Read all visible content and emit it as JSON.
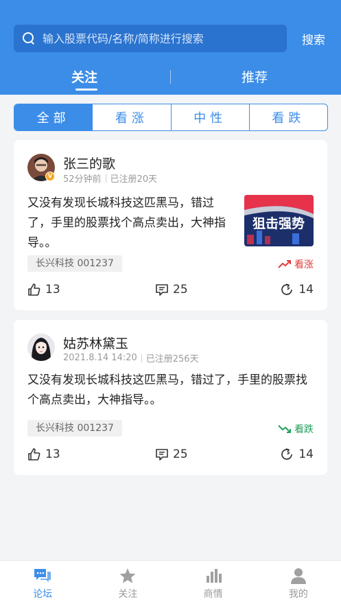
{
  "header": {
    "search_placeholder": "输入股票代码/名称/简称进行搜索",
    "search_button": "搜索",
    "tabs": [
      {
        "label": "关注",
        "active": true
      },
      {
        "label": "推荐",
        "active": false
      }
    ]
  },
  "filter": {
    "options": [
      "全部",
      "看涨",
      "中性",
      "看跌"
    ],
    "selected": "全部"
  },
  "posts": [
    {
      "username": "张三的歌",
      "time": "52分钟前",
      "registered": "已注册20天",
      "verified": true,
      "content": "又没有发现长城科技这匹黑马，错过了，手里的股票找个高点卖出，大神指导。。",
      "thumbnail_text": "狙击强势",
      "stock": "长兴科技 001237",
      "trend": "看涨",
      "trend_color": "#e23b3b",
      "likes": "13",
      "comments": "25",
      "shares": "14"
    },
    {
      "username": "姑苏林黛玉",
      "time": "2021.8.14 14:20",
      "registered": "已注册256天",
      "verified": false,
      "content": "又没有发现长城科技这匹黑马，错过了，手里的股票找个高点卖出，大神指导。。",
      "stock": "长兴科技 001237",
      "trend": "看跌",
      "trend_color": "#22a05b",
      "likes": "13",
      "comments": "25",
      "shares": "14"
    }
  ],
  "bottom_nav": [
    {
      "label": "论坛",
      "icon": "chat-bubbles-icon",
      "active": true
    },
    {
      "label": "关注",
      "icon": "star-icon",
      "active": false
    },
    {
      "label": "商情",
      "icon": "bar-chart-icon",
      "active": false
    },
    {
      "label": "我的",
      "icon": "user-icon",
      "active": false
    }
  ],
  "colors": {
    "primary": "#3c8de8",
    "bullish": "#e23b3b",
    "bearish": "#22a05b"
  }
}
